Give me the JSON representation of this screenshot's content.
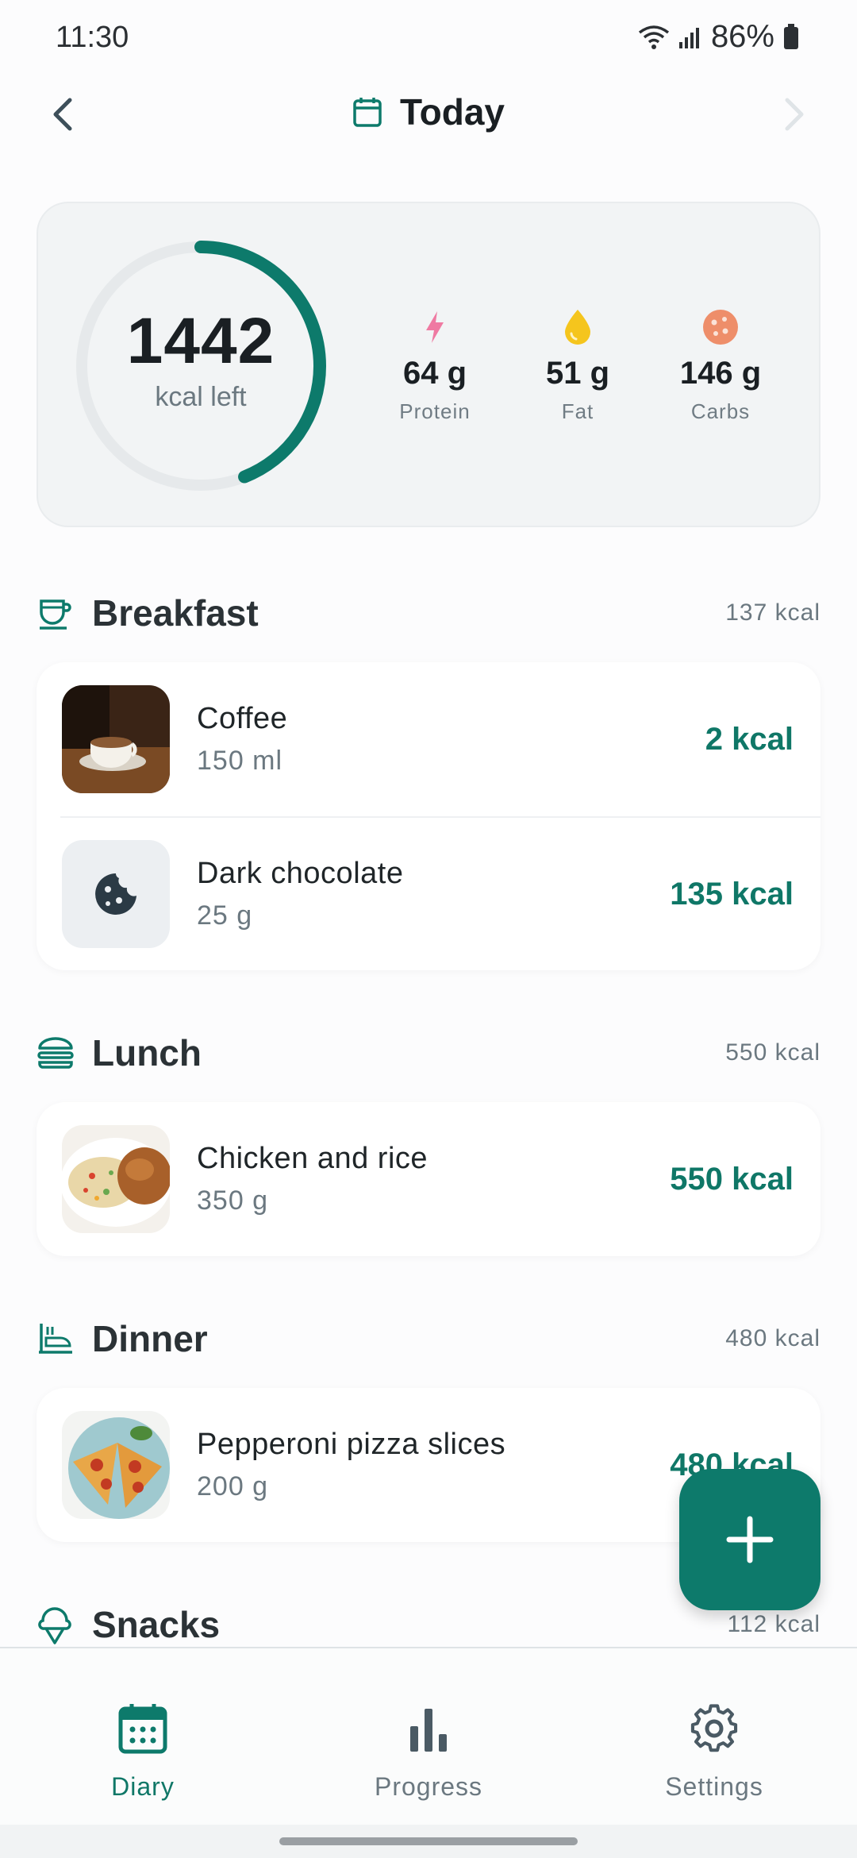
{
  "status_bar": {
    "time": "11:30",
    "battery": "86%"
  },
  "header": {
    "title": "Today"
  },
  "summary": {
    "kcal_left": "1442",
    "kcal_left_label": "kcal left",
    "ring_progress_fraction": 0.44,
    "macros": [
      {
        "value": "64 g",
        "label": "Protein",
        "icon": "bolt-icon",
        "color": "#ef7aa2"
      },
      {
        "value": "51 g",
        "label": "Fat",
        "icon": "drop-icon",
        "color": "#f5c51d"
      },
      {
        "value": "146 g",
        "label": "Carbs",
        "icon": "cookie-icon",
        "color": "#ee8e6a"
      }
    ]
  },
  "meals": {
    "breakfast": {
      "title": "Breakfast",
      "kcal": "137 kcal",
      "items": [
        {
          "name": "Coffee",
          "amount": "150 ml",
          "kcal": "2 kcal"
        },
        {
          "name": "Dark chocolate",
          "amount": "25 g",
          "kcal": "135 kcal"
        }
      ]
    },
    "lunch": {
      "title": "Lunch",
      "kcal": "550 kcal",
      "items": [
        {
          "name": "Chicken and rice",
          "amount": "350 g",
          "kcal": "550 kcal"
        }
      ]
    },
    "dinner": {
      "title": "Dinner",
      "kcal": "480 kcal",
      "items": [
        {
          "name": "Pepperoni pizza slices",
          "amount": "200 g",
          "kcal": "480 kcal"
        }
      ]
    },
    "snacks": {
      "title": "Snacks",
      "kcal": "112 kcal"
    }
  },
  "nav": {
    "diary": "Diary",
    "progress": "Progress",
    "settings": "Settings"
  },
  "colors": {
    "accent": "#0d7a6b",
    "ring_track": "#e6e9eb"
  }
}
